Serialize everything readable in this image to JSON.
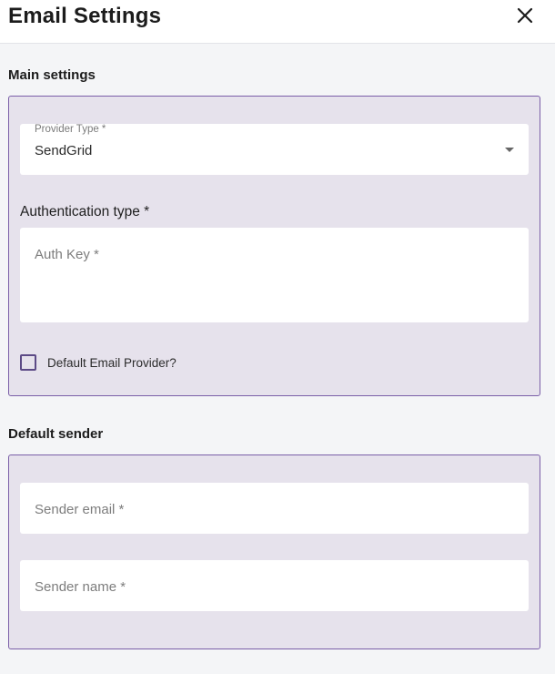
{
  "header": {
    "title": "Email Settings",
    "close_icon": "close-icon"
  },
  "main_settings": {
    "heading": "Main settings",
    "provider_type": {
      "label": "Provider Type *",
      "value": "SendGrid"
    },
    "authentication": {
      "label": "Authentication type *",
      "auth_key_placeholder": "Auth Key *"
    },
    "default_provider": {
      "label": "Default Email Provider?",
      "checked": false
    }
  },
  "default_sender": {
    "heading": "Default sender",
    "sender_email_placeholder": "Sender email *",
    "sender_name_placeholder": "Sender name *"
  },
  "colors": {
    "panel_background": "#e6e2ec",
    "panel_border": "#7a5ea8",
    "page_background": "#f4f5f7"
  }
}
